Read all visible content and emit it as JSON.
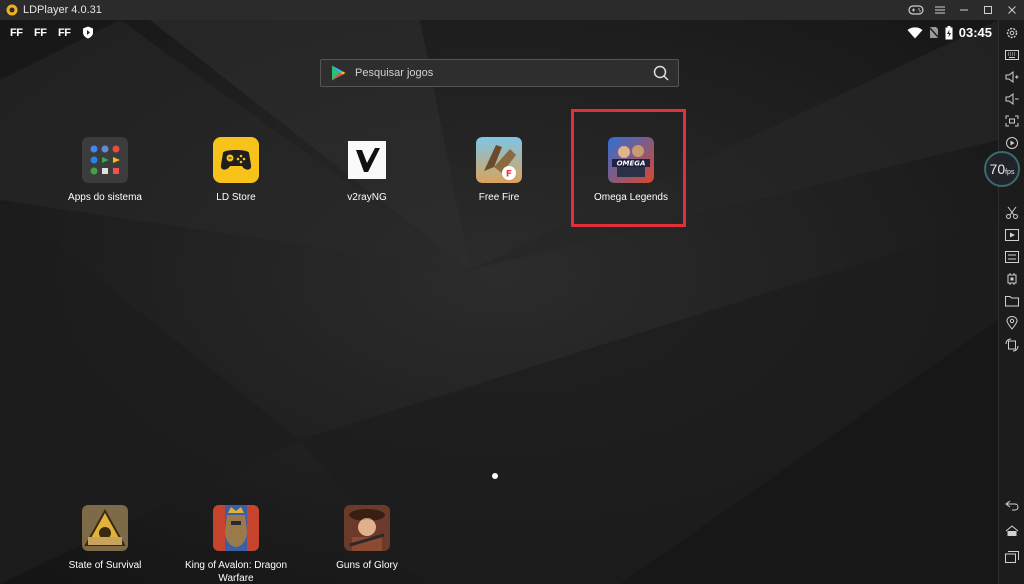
{
  "window": {
    "title": "LDPlayer 4.0.31"
  },
  "statusbar": {
    "left_icons": [
      "FF",
      "FF",
      "FF"
    ],
    "time": "03:45"
  },
  "search": {
    "placeholder": "Pesquisar jogos"
  },
  "apps_top": [
    {
      "label": "Apps do sistema"
    },
    {
      "label": "LD Store"
    },
    {
      "label": "v2rayNG"
    },
    {
      "label": "Free Fire"
    },
    {
      "label": "Omega Legends"
    }
  ],
  "apps_bottom": [
    {
      "label": "State of Survival"
    },
    {
      "label": "King of Avalon: Dragon Warfare"
    },
    {
      "label": "Guns of Glory"
    }
  ],
  "fps": {
    "value": "70",
    "unit": "fps"
  },
  "colors": {
    "highlight": "#e0303a",
    "ldstore_yellow": "#f7c21a"
  }
}
